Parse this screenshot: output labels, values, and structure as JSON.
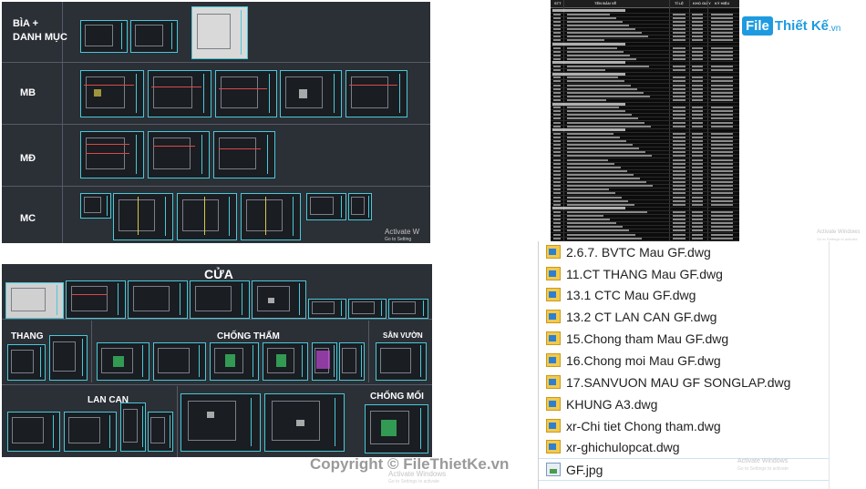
{
  "top_panel": {
    "rows": [
      {
        "label": "BÌA +",
        "label2": "DANH MỤC"
      },
      {
        "label": "MB"
      },
      {
        "label": "MĐ"
      },
      {
        "label": "MC"
      }
    ],
    "watermark": {
      "line1": "Activate W",
      "line2": "Go to Setting"
    }
  },
  "bottom_panel": {
    "title": "CỬA",
    "sections": {
      "thang": "THANG",
      "chong_tham": "CHỐNG THẤM",
      "san_vuon": "SÂN VƯỜN",
      "lan_can": "LAN CAN",
      "chong_moi": "CHỐNG MỐI"
    },
    "watermark": {
      "line1": "Activate Windows",
      "line2": "Go to Settings to activate"
    }
  },
  "table": {
    "headers": [
      "STT",
      "TÊN BẢN VẼ",
      "TỈ LỆ",
      "KHỔ GIẤY",
      "KÝ HIỆU"
    ],
    "watermark": {
      "line1": "Activate Windows",
      "line2": "Go to Settings to activate"
    }
  },
  "logo": {
    "mark": "File",
    "text": "Thiết Kế",
    "tld": ".vn"
  },
  "files": [
    {
      "name": "2.6.7. BVTC Mau GF.dwg",
      "icon": "dwg-file-icon"
    },
    {
      "name": "11.CT THANG Mau GF.dwg",
      "icon": "dwg-file-icon"
    },
    {
      "name": "13.1 CTC Mau GF.dwg",
      "icon": "dwg-file-icon"
    },
    {
      "name": "13.2 CT LAN CAN GF.dwg",
      "icon": "dwg-file-icon"
    },
    {
      "name": "15.Chong tham Mau GF.dwg",
      "icon": "dwg-file-icon"
    },
    {
      "name": "16.Chong moi Mau GF.dwg",
      "icon": "dwg-file-icon"
    },
    {
      "name": "17.SANVUON MAU GF SONGLAP.dwg",
      "icon": "dwg-file-icon"
    },
    {
      "name": "KHUNG A3.dwg",
      "icon": "dwg-file-icon"
    },
    {
      "name": "xr-Chi tiet Chong tham.dwg",
      "icon": "dwg-file-icon"
    },
    {
      "name": "xr-ghichulopcat.dwg",
      "icon": "dwg-file-icon"
    },
    {
      "name": "GF.jpg",
      "icon": "image-file-icon"
    }
  ],
  "files_watermark": {
    "line1": "Activate Windows",
    "line2": "Go to Settings to activate"
  },
  "copyright": "Copyright © FileThietKe.vn",
  "colors": {
    "cad_bg": "#2b2f36",
    "sheet_border": "#49c9d8",
    "logo": "#1e9be0"
  }
}
